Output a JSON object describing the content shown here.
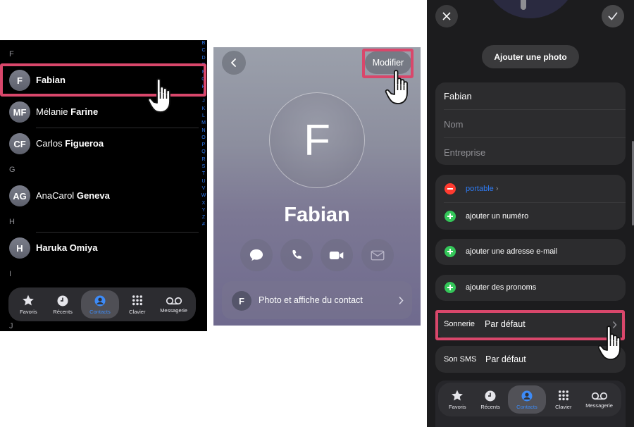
{
  "colors": {
    "highlight": "#d9476b",
    "accent": "#2f7cf6",
    "add": "#34c759",
    "remove": "#ff3b30"
  },
  "list": {
    "sections": [
      {
        "letter": "F",
        "contacts": [
          {
            "initials": "F",
            "first": "Fabian",
            "last": "",
            "bold_first": true
          },
          {
            "initials": "MF",
            "first": "Mélanie",
            "last": "Farine"
          },
          {
            "initials": "CF",
            "first": "Carlos",
            "last": "Figueroa"
          }
        ]
      },
      {
        "letter": "G",
        "contacts": [
          {
            "initials": "AG",
            "first": "AnaCarol",
            "last": "Geneva"
          }
        ]
      },
      {
        "letter": "H",
        "contacts": [
          {
            "initials": "H",
            "first": "Haruka Omiya",
            "last": "",
            "bold_first": true
          }
        ]
      },
      {
        "letter": "I",
        "contacts": []
      },
      {
        "letter": "J",
        "contacts": []
      }
    ],
    "index_letters": [
      "B",
      "C",
      "D",
      "E",
      "F",
      "G",
      "H",
      "I",
      "J",
      "K",
      "L",
      "M",
      "N",
      "O",
      "P",
      "Q",
      "R",
      "S",
      "T",
      "U",
      "V",
      "W",
      "X",
      "Y",
      "Z",
      "#"
    ],
    "tabs": [
      {
        "label": "Favoris",
        "icon": "star-icon"
      },
      {
        "label": "Récents",
        "icon": "clock-icon"
      },
      {
        "label": "Contacts",
        "icon": "person-circle-icon",
        "active": true
      },
      {
        "label": "Clavier",
        "icon": "keypad-icon"
      },
      {
        "label": "Messagerie",
        "icon": "voicemail-icon"
      }
    ]
  },
  "card": {
    "edit_label": "Modifier",
    "initial": "F",
    "name": "Fabian",
    "actions": [
      "message-icon",
      "phone-icon",
      "video-icon",
      "mail-icon"
    ],
    "poster_initial": "F",
    "poster_label": "Photo et affiche du contact"
  },
  "edit": {
    "add_photo": "Ajouter une photo",
    "first_name": "Fabian",
    "last_placeholder": "Nom",
    "company_placeholder": "Entreprise",
    "phone_label": "portable",
    "add_phone": "ajouter un numéro",
    "add_email": "ajouter une adresse e-mail",
    "add_pronouns": "ajouter des pronoms",
    "ringtone_label": "Sonnerie",
    "ringtone_value": "Par défaut",
    "sms_label": "Son SMS",
    "sms_value": "Par défaut",
    "tabs": [
      {
        "label": "Favoris",
        "icon": "star-icon"
      },
      {
        "label": "Récents",
        "icon": "clock-icon"
      },
      {
        "label": "Contacts",
        "icon": "person-circle-icon",
        "active": true
      },
      {
        "label": "Clavier",
        "icon": "keypad-icon"
      },
      {
        "label": "Messagerie",
        "icon": "voicemail-icon"
      }
    ]
  }
}
